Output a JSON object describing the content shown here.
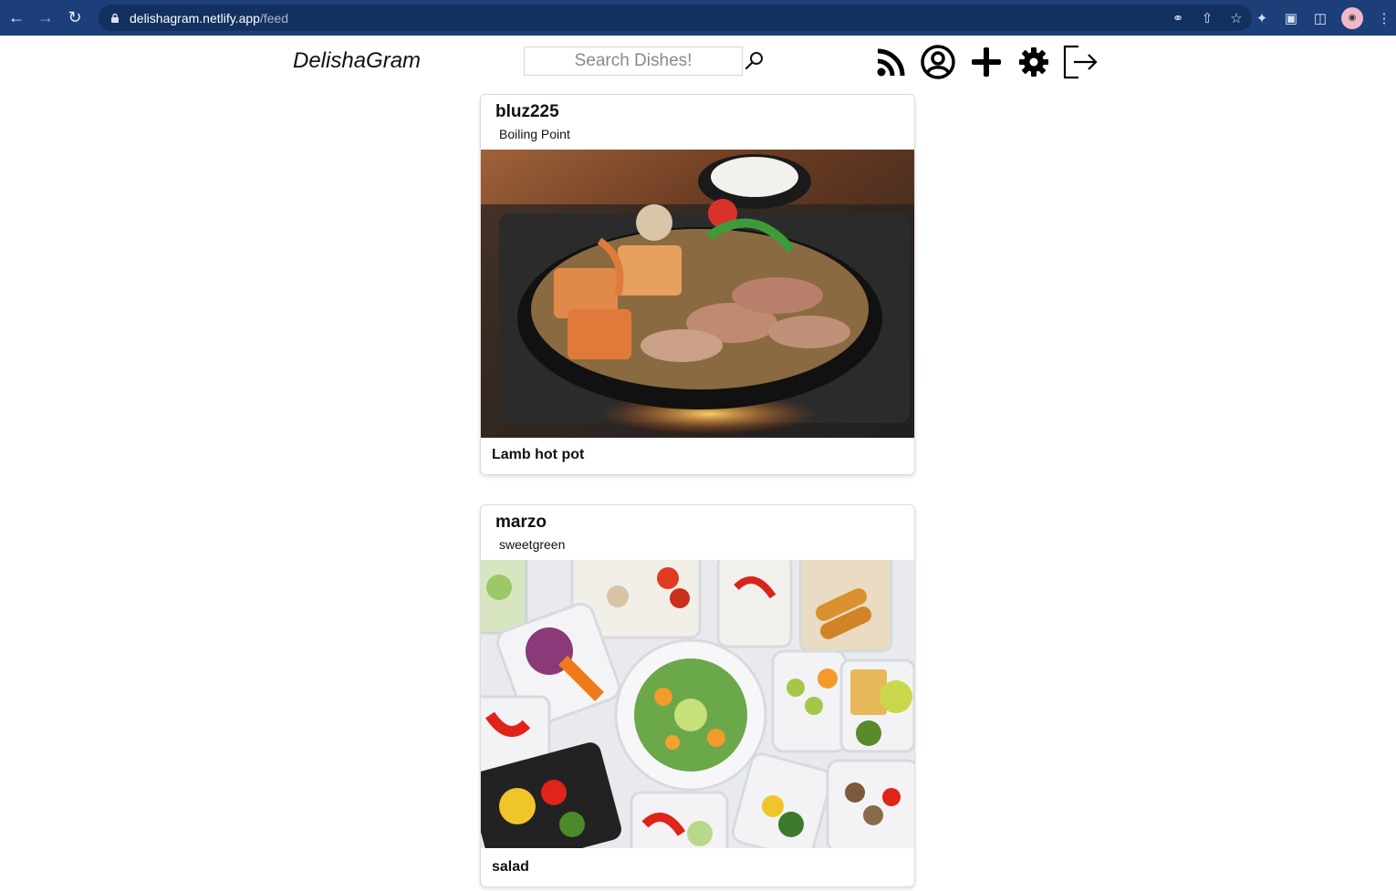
{
  "browser": {
    "url_host": "delishagram.netlify.app",
    "url_path": "/feed"
  },
  "header": {
    "brand": "DelishaGram",
    "search_placeholder": "Search Dishes!",
    "icons": [
      "search-icon",
      "rss-feed-icon",
      "user-profile-icon",
      "add-post-icon",
      "settings-gear-icon",
      "logout-icon"
    ]
  },
  "feed": {
    "posts": [
      {
        "username": "bluz225",
        "restaurant": "Boiling Point",
        "dish": "Lamb hot pot",
        "photo": "hot-pot-photo"
      },
      {
        "username": "marzo",
        "restaurant": "sweetgreen",
        "dish": "salad",
        "photo": "salad-photo"
      }
    ]
  },
  "colors": {
    "chrome_bg": "#1c3f7a",
    "urlbar_bg": "#12315f",
    "card_border": "#dcdcdc",
    "text": "#111111"
  }
}
